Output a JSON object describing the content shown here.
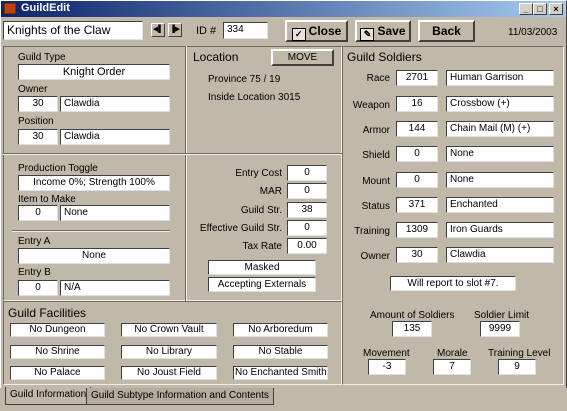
{
  "window": {
    "title": "GuildEdit"
  },
  "header": {
    "guild_name": "Knights of the Claw",
    "id_label": "ID #",
    "id_value": "334",
    "close_label": "Close",
    "save_label": "Save",
    "back_label": "Back",
    "date": "11/03/2003"
  },
  "guild": {
    "type_label": "Guild Type",
    "type_value": "Knight Order",
    "owner_label": "Owner",
    "owner_num": "30",
    "owner_name": "Clawdia",
    "position_label": "Position",
    "position_num": "30",
    "position_name": "Clawdia"
  },
  "location": {
    "header": "Location",
    "move_label": "MOVE",
    "province": "Province 75 / 19",
    "inside": "Inside Location 3015"
  },
  "production": {
    "toggle_label": "Production Toggle",
    "toggle_value": "Income 0%;  Strength 100%",
    "item_label": "Item to Make",
    "item_num": "0",
    "item_name": "None",
    "entry_a_label": "Entry A",
    "entry_a_value": "None",
    "entry_b_label": "Entry B",
    "entry_b_num": "0",
    "entry_b_name": "N/A"
  },
  "costs": {
    "entry_cost_label": "Entry Cost",
    "entry_cost": "0",
    "mar_label": "MAR",
    "mar": "0",
    "guild_str_label": "Guild Str.",
    "guild_str": "38",
    "eff_str_label": "Effective Guild Str.",
    "eff_str": "0",
    "tax_label": "Tax Rate",
    "tax": "0.00",
    "masked": "Masked",
    "externals": "Accepting Externals"
  },
  "soldiers": {
    "header": "Guild Soldiers",
    "rows": [
      {
        "label": "Race",
        "num": "2701",
        "name": "Human Garrison"
      },
      {
        "label": "Weapon",
        "num": "16",
        "name": "Crossbow (+)"
      },
      {
        "label": "Armor",
        "num": "144",
        "name": "Chain Mail (M) (+)"
      },
      {
        "label": "Shield",
        "num": "0",
        "name": "None"
      },
      {
        "label": "Mount",
        "num": "0",
        "name": "None"
      },
      {
        "label": "Status",
        "num": "371",
        "name": "Enchanted"
      },
      {
        "label": "Training",
        "num": "1309",
        "name": "Iron Guards"
      },
      {
        "label": "Owner",
        "num": "30",
        "name": "Clawdia"
      }
    ],
    "report": "Will report to slot #7.",
    "amount_label": "Amount of Soldiers",
    "amount": "135",
    "limit_label": "Soldier Limit",
    "limit": "9999",
    "movement_label": "Movement",
    "movement": "-3",
    "morale_label": "Morale",
    "morale": "7",
    "training_level_label": "Training Level",
    "training_level": "9"
  },
  "facilities": {
    "header": "Guild Facilities",
    "items": [
      "No Dungeon",
      "No Crown Vault",
      "No Arboredum",
      "No Shrine",
      "No Library",
      "No Stable",
      "No Palace",
      "No Joust Field",
      "No Enchanted Smithy"
    ]
  },
  "tabs": [
    "Guild Information",
    "Guild Subtype Information and Contents"
  ]
}
